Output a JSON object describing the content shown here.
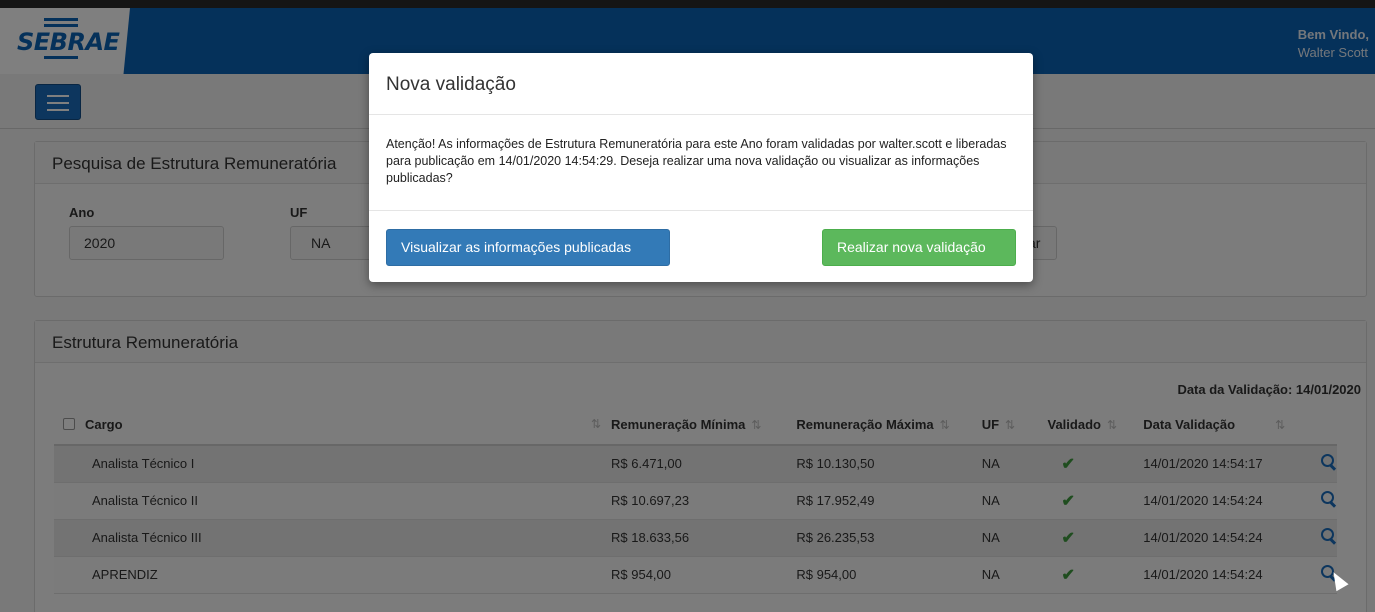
{
  "header": {
    "brand": "SEBRAE",
    "welcome_line1": "Bem Vindo,",
    "welcome_line2": "Walter Scott"
  },
  "search_panel": {
    "title": "Pesquisa de Estrutura Remuneratória",
    "ano_label": "Ano",
    "ano_value": "2020",
    "uf_label": "UF",
    "uf_value": "NA",
    "hidden_button_fragment": "ar"
  },
  "table_panel": {
    "title": "Estrutura Remuneratória",
    "validation_date": "Data da Validação: 14/01/2020",
    "columns": [
      "Cargo",
      "Remuneração Mínima",
      "Remuneração Máxima",
      "UF",
      "Validado",
      "Data Validação"
    ],
    "rows": [
      {
        "cargo": "Analista Técnico I",
        "min": "R$ 6.471,00",
        "max": "R$ 10.130,50",
        "uf": "NA",
        "validated": true,
        "date": "14/01/2020 14:54:17"
      },
      {
        "cargo": "Analista Técnico II",
        "min": "R$ 10.697,23",
        "max": "R$ 17.952,49",
        "uf": "NA",
        "validated": true,
        "date": "14/01/2020 14:54:24"
      },
      {
        "cargo": "Analista Técnico III",
        "min": "R$ 18.633,56",
        "max": "R$ 26.235,53",
        "uf": "NA",
        "validated": true,
        "date": "14/01/2020 14:54:24"
      },
      {
        "cargo": "APRENDIZ",
        "min": "R$ 954,00",
        "max": "R$ 954,00",
        "uf": "NA",
        "validated": true,
        "date": "14/01/2020 14:54:24"
      }
    ]
  },
  "modal": {
    "title": "Nova validação",
    "body": "Atenção! As informações de Estrutura Remuneratória para este Ano foram validadas por walter.scott e liberadas para publicação em 14/01/2020 14:54:29. Deseja realizar uma nova validação ou visualizar as informações publicadas?",
    "primary_button": "Visualizar as informações publicadas",
    "success_button": "Realizar nova validação"
  },
  "colors": {
    "header_blue": "#0b62b5",
    "primary": "#337ab7",
    "success": "#5cb85c",
    "check_green": "#3e9a3e"
  },
  "icons": [
    "menu-icon",
    "check-icon",
    "search-icon",
    "sort-icon",
    "mouse-cursor-icon"
  ]
}
